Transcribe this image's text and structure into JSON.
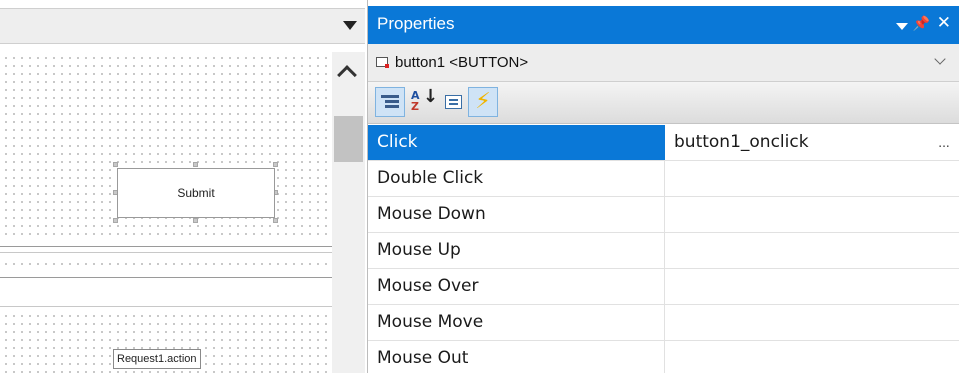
{
  "properties_panel": {
    "title": "Properties",
    "selected_object": "button1 <BUTTON>",
    "toolbar": {
      "categorized_icon": "categorized-icon",
      "alphabetical_icon": "alphabetical-sort-icon",
      "properties_icon": "properties-page-icon",
      "events_icon": "lightning-events-icon"
    },
    "events": [
      {
        "name": "Click",
        "value": "button1_onclick",
        "selected": true
      },
      {
        "name": "Double Click",
        "value": ""
      },
      {
        "name": "Mouse Down",
        "value": ""
      },
      {
        "name": "Mouse Up",
        "value": ""
      },
      {
        "name": "Mouse Over",
        "value": ""
      },
      {
        "name": "Mouse Move",
        "value": ""
      },
      {
        "name": "Mouse Out",
        "value": ""
      }
    ],
    "ellipsis": "...",
    "colors": {
      "accent": "#0a78d7",
      "title_text": "#ffffff"
    }
  },
  "designer": {
    "submit_button_label": "Submit",
    "request_label": "Request1.action"
  }
}
